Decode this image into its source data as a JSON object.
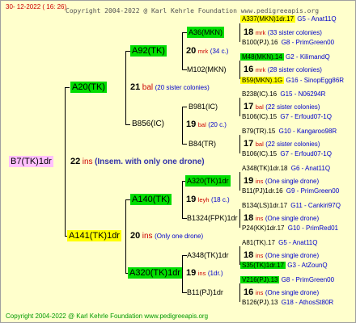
{
  "date": "30- 12-2022 ( 16: 26)",
  "copyright": "Copyright 2004-2022 @ Karl Kehrle Foundation www.pedigreeapis.org",
  "watermark": "Copyright 2004-2022 @ Karl Kehrle Foundation www.pedigreeapis.org",
  "root": {
    "label": "B7(TK)1dr",
    "num": "22",
    "ins": "ins",
    "note": "(Insem. with only one drone)"
  },
  "upper": {
    "label": "A20(TK)",
    "num": "21",
    "ins": "bal",
    "note": "(20 sister colonies)"
  },
  "lower": {
    "label": "A141(TK)1dr",
    "num": "20",
    "ins": "ins",
    "note": "(Only one drone)"
  },
  "g3": [
    {
      "label": "A92(TK)",
      "num": "20",
      "ins": "mrk",
      "note": "(34 c.)"
    },
    {
      "label": "B856(IC)",
      "num": "19",
      "ins": "bal",
      "note": "(20 c.)"
    },
    {
      "label": "A140(TK)",
      "num": "19",
      "ins": "leyh",
      "note": "(18 c.)"
    },
    {
      "label": "A320(TK)1dr",
      "num": "19",
      "ins": "ins",
      "note": "(1dr.)"
    }
  ],
  "g4": [
    {
      "label": "A36(MKN)",
      "num": "18",
      "ins": "mrk",
      "note": "(33 sister colonies)"
    },
    {
      "label": "M102(MKN)",
      "num": "16",
      "ins": "mrk",
      "note": "(28 sister colonies)"
    },
    {
      "label": "B981(IC)",
      "num": "17",
      "ins": "bal",
      "note": "(22 sister colonies)"
    },
    {
      "label": "B84(TR)",
      "num": "17",
      "ins": "bal",
      "note": "(22 sister colonies)"
    },
    {
      "label": "A320(TK)1dr",
      "num": "19",
      "ins": "ins",
      "note": "(One single drone)"
    },
    {
      "label": "B1324(FPK)1dr",
      "num": "18",
      "ins": "ins",
      "note": "(One single drone)"
    },
    {
      "label": "A348(TK)1dr",
      "num": "18",
      "ins": "ins",
      "note": "(One single drone)"
    },
    {
      "label": "B11(PJ)1dr",
      "num": "16",
      "ins": "ins",
      "note": "(One single drone)"
    }
  ],
  "g5": [
    {
      "label": "A337(MKN)1dr.17",
      "code": "G5 - Anat11Q"
    },
    {
      "label": "B100(PJ).16",
      "code": "G8 - PrimGreen00"
    },
    {
      "label": "M48(MKN).14",
      "code": "G2 - KilimandQ"
    },
    {
      "label": "B59(MKN).1G",
      "code": "G16 - SinopEgg86R"
    },
    {
      "label": "B238(IC).16",
      "code": "G15 - N06294R"
    },
    {
      "label": "B106(IC).15",
      "code": "G7 - Erfoud07-1Q"
    },
    {
      "label": "B79(TR).15",
      "code": "G10 - Kangaroo98R"
    },
    {
      "label": "B106(IC).15",
      "code": "G7 - Erfoud07-1Q"
    },
    {
      "label": "A348(TK)1dr.18",
      "code": "G6 - Anat11Q"
    },
    {
      "label": "B11(PJ)1dr.16",
      "code": "G9 - PrimGreen00"
    },
    {
      "label": "B134(LS)1dr.17",
      "code": "G11 - Cankiri97Q"
    },
    {
      "label": "P24(KK)1dr.17",
      "code": "G10 - PrimRed01"
    },
    {
      "label": "A81(TK).17",
      "code": "G5 - Anat11Q"
    },
    {
      "label": "S35(TK)1dr.17",
      "code": "G3 - AtZounQ"
    },
    {
      "label": "V216(PJ).13",
      "code": "G8 - PrimGreen00"
    },
    {
      "label": "B126(PJ).13",
      "code": "G18 - AthosSt80R"
    }
  ]
}
